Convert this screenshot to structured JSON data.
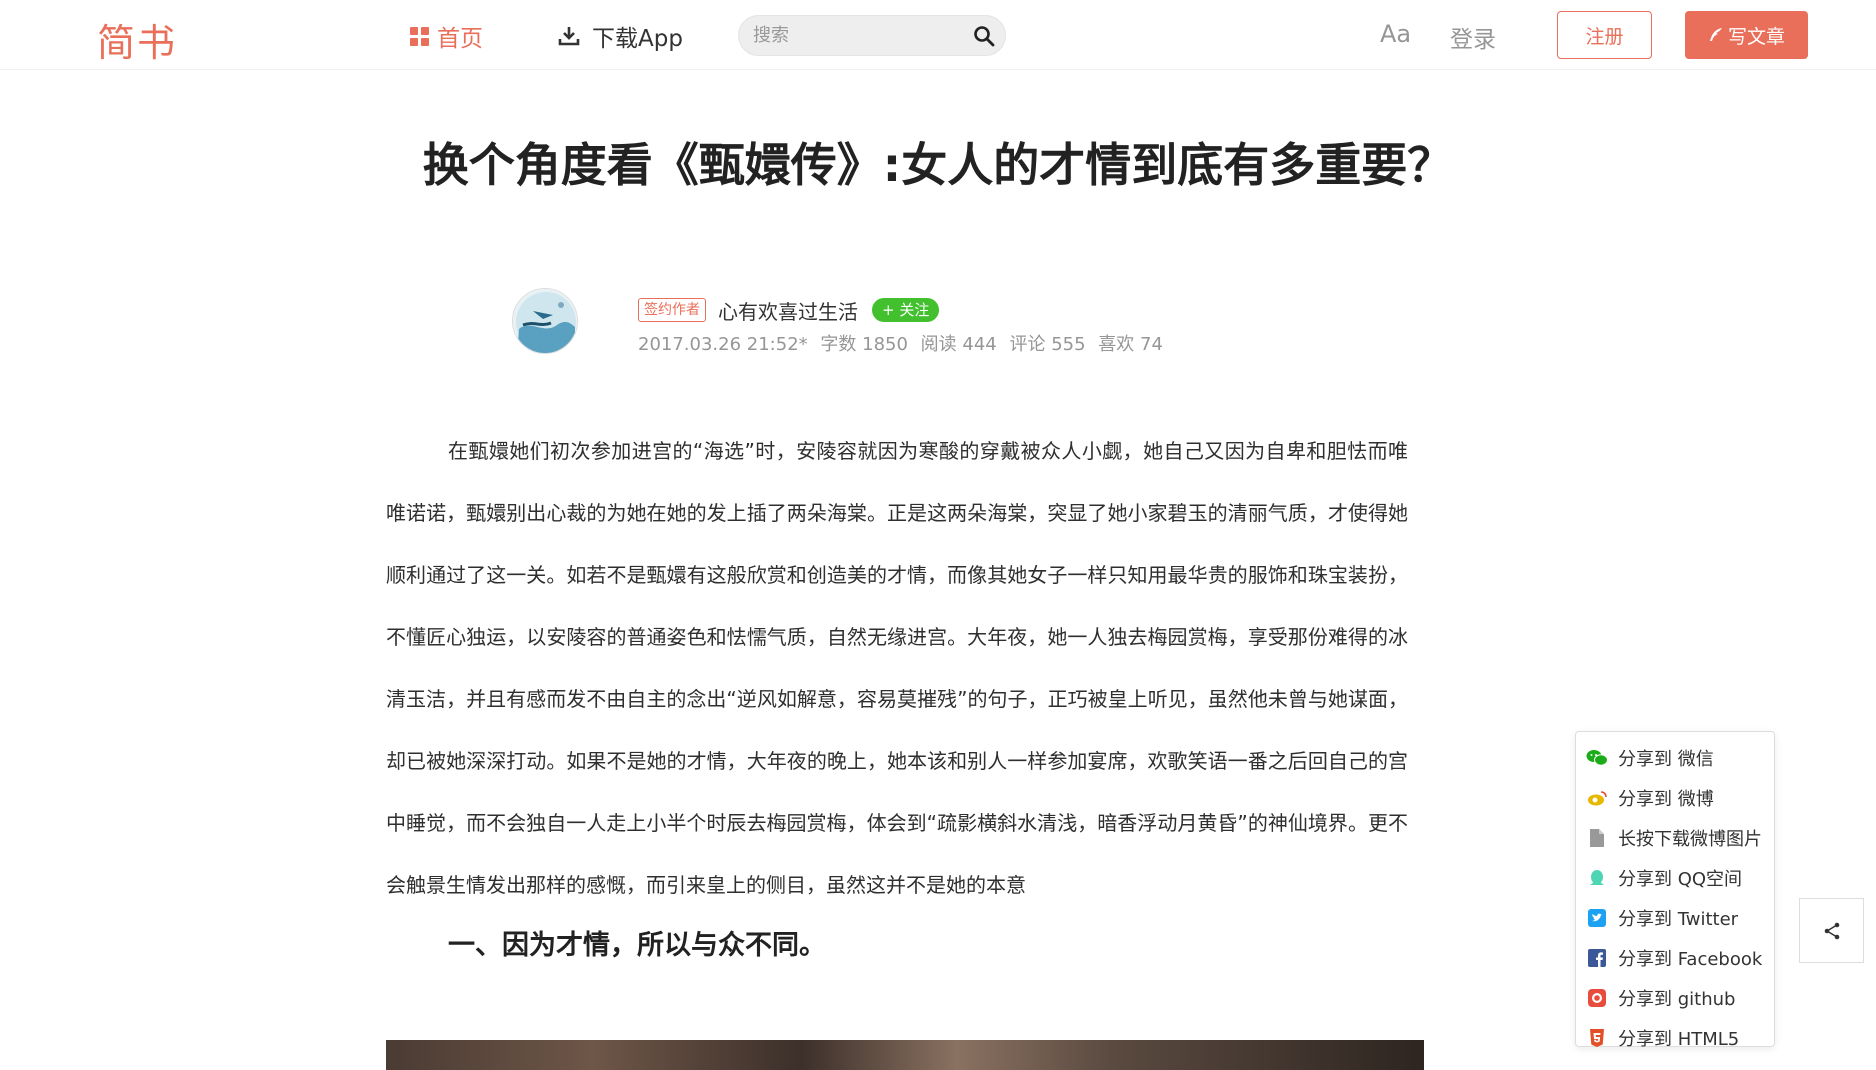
{
  "header": {
    "logo": "简书",
    "nav_home": "首页",
    "nav_app": "下载App",
    "search_placeholder": "搜索",
    "aa": "Aa",
    "login": "登录",
    "register": "注册",
    "write": "写文章"
  },
  "article": {
    "title": "换个角度看《甄嬛传》:女人的才情到底有多重要？",
    "badge": "签约作者",
    "author": "心有欢喜过生活",
    "follow": "+ 关注",
    "meta": {
      "date": "2017.03.26 21:52*",
      "words": "字数 1850",
      "reads": "阅读 444",
      "comments": "评论 555",
      "likes": "喜欢 74"
    },
    "paragraph": "在甄嬛她们初次参加进宫的“海选”时，安陵容就因为寒酸的穿戴被众人小觑，她自己又因为自卑和胆怯而唯唯诺诺，甄嬛别出心裁的为她在她的发上插了两朵海棠。正是这两朵海棠，突显了她小家碧玉的清丽气质，才使得她顺利通过了这一关。如若不是甄嬛有这般欣赏和创造美的才情，而像其她女子一样只知用最华贵的服饰和珠宝装扮，不懂匠心独运，以安陵容的普通姿色和怯懦气质，自然无缘进宫。大年夜，她一人独去梅园赏梅，享受那份难得的冰清玉洁，并且有感而发不由自主的念出“逆风如解意，容易莫摧残”的句子，正巧被皇上听见，虽然他未曾与她谋面，却已被她深深打动。如果不是她的才情，大年夜的晚上，她本该和别人一样参加宴席，欢歌笑语一番之后回自己的宫中睡觉，而不会独自一人走上小半个时辰去梅园赏梅，体会到“疏影横斜水清浅，暗香浮动月黄昏”的神仙境界。更不会触景生情发出那样的感慨，而引来皇上的侧目，虽然这并不是她的本意",
    "heading": "一、因为才情，所以与众不同。"
  },
  "share": {
    "items": [
      {
        "label": "分享到 微信",
        "icon": "wechat-icon",
        "color": "#1aad19"
      },
      {
        "label": "分享到 微博",
        "icon": "weibo-icon",
        "color": "#e6b800"
      },
      {
        "label": "长按下载微博图片",
        "icon": "file-icon",
        "color": "#999999"
      },
      {
        "label": "分享到 QQ空间",
        "icon": "qzone-icon",
        "color": "#4ed6b4"
      },
      {
        "label": "分享到 Twitter",
        "icon": "twitter-icon",
        "color": "#1da1f2"
      },
      {
        "label": "分享到 Facebook",
        "icon": "facebook-icon",
        "color": "#3b5998"
      },
      {
        "label": "分享到 github",
        "icon": "github-icon",
        "color": "#e74c3c"
      },
      {
        "label": "分享到 HTML5",
        "icon": "html5-icon",
        "color": "#e34f26"
      }
    ]
  },
  "colors": {
    "accent": "#ea6f5a",
    "follow_green": "#42c02e",
    "meta_gray": "#969696"
  }
}
